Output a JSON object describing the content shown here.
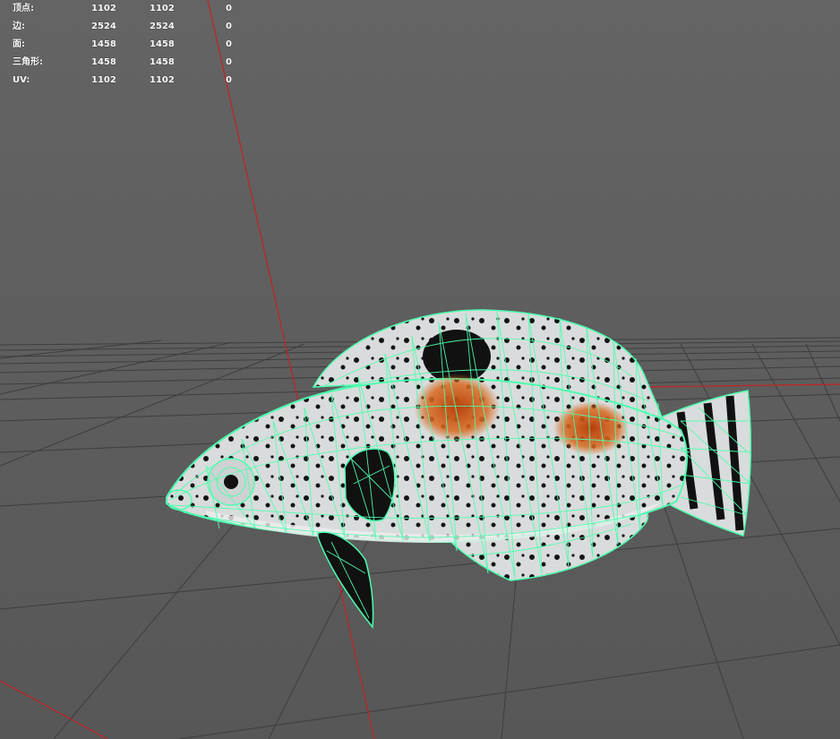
{
  "hud": {
    "rows": [
      {
        "label": "顶点:",
        "values": [
          "1102",
          "1102",
          "0"
        ]
      },
      {
        "label": "边:",
        "values": [
          "2524",
          "2524",
          "0"
        ]
      },
      {
        "label": "面:",
        "values": [
          "1458",
          "1458",
          "0"
        ]
      },
      {
        "label": "三角形:",
        "values": [
          "1458",
          "1458",
          "0"
        ]
      },
      {
        "label": "UV:",
        "values": [
          "1102",
          "1102",
          "0"
        ]
      }
    ]
  },
  "colors": {
    "background": "#5b5b5b",
    "grid": "#3c3c3c",
    "axis": "#cc2020",
    "wireframe": "#4dffb0",
    "fish_body": "#d8d8d8",
    "fish_spots": "#1a1a1a",
    "fish_orange": "#d2641e"
  },
  "viewport": {
    "object": "fish-model",
    "display_mode": "wireframe-on-shaded"
  }
}
